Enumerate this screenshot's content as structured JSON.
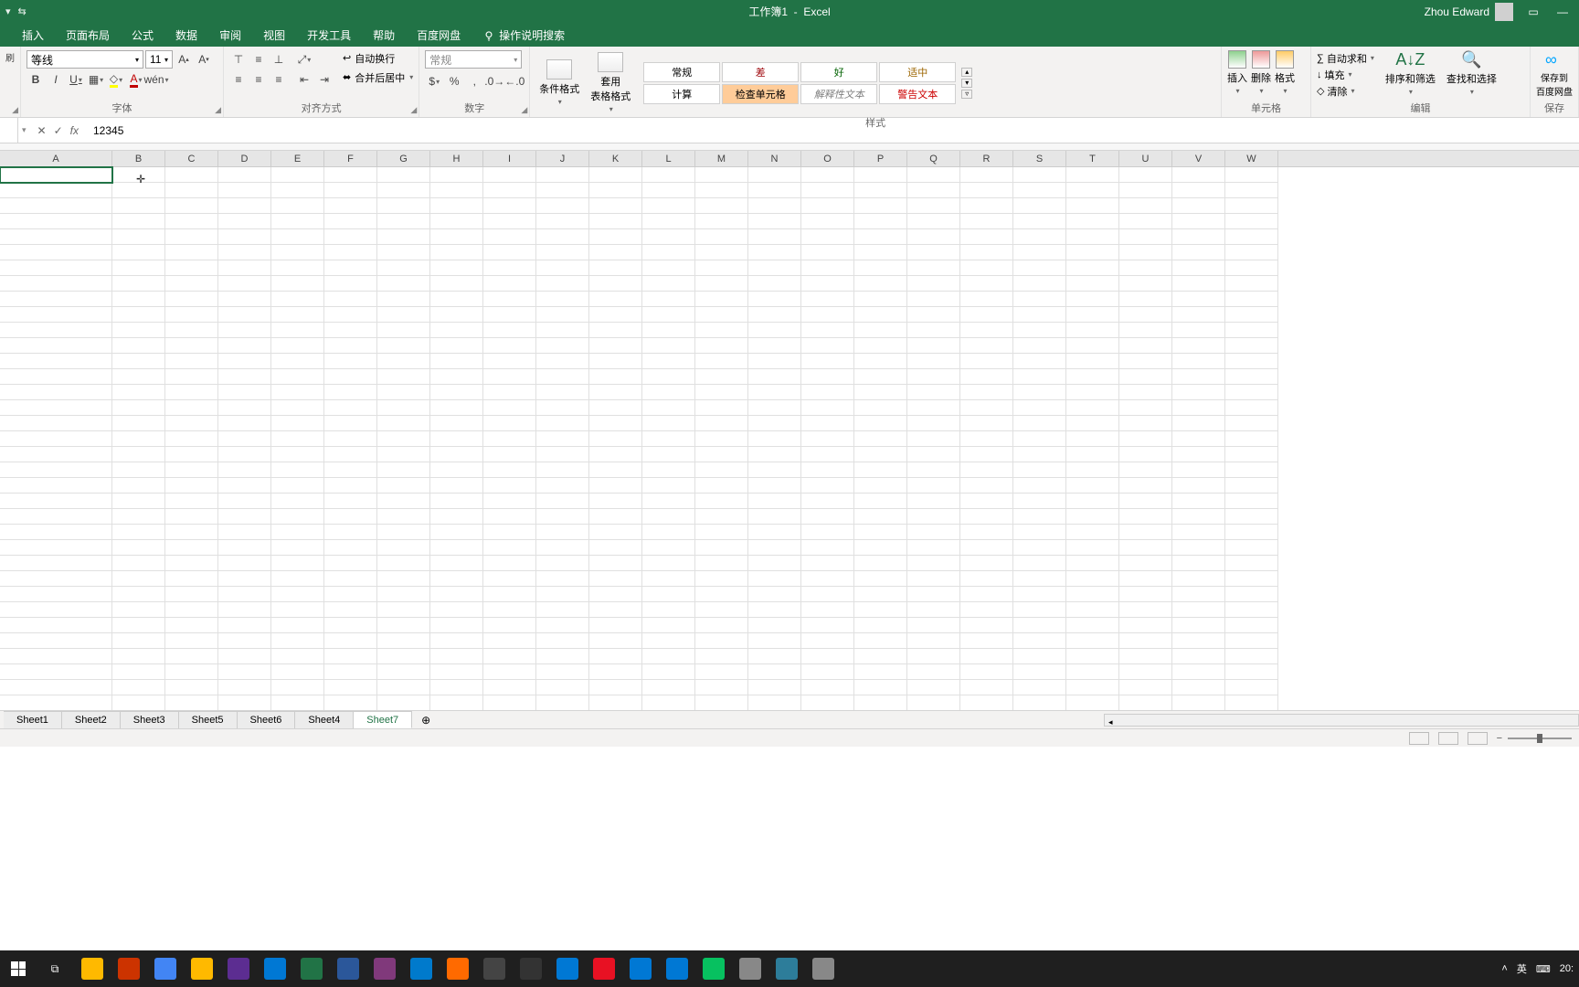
{
  "title": {
    "doc": "工作簿1",
    "sep": "-",
    "app": "Excel"
  },
  "user": {
    "name": "Zhou Edward"
  },
  "winctrl": {
    "min": "—",
    "restore": "❐"
  },
  "tabs": [
    "插入",
    "页面布局",
    "公式",
    "数据",
    "审阅",
    "视图",
    "开发工具",
    "帮助",
    "百度网盘"
  ],
  "tell_me": "操作说明搜索",
  "font": {
    "name": "等线",
    "size": "11",
    "label": "字体",
    "bold": "B",
    "italic": "I",
    "underline": "U",
    "grow": "A",
    "shrink": "A"
  },
  "align": {
    "label": "对齐方式",
    "wrap": "自动换行",
    "merge": "合并后居中"
  },
  "number": {
    "label": "数字",
    "format": "常规"
  },
  "styles": {
    "label": "样式",
    "cond": "条件格式",
    "table": "套用\n表格格式",
    "gallery": [
      "常规",
      "差",
      "好",
      "适中",
      "计算",
      "检查单元格",
      "解释性文本",
      "警告文本"
    ]
  },
  "cells": {
    "label": "单元格",
    "insert": "插入",
    "delete": "删除",
    "format": "格式"
  },
  "edit": {
    "label": "编辑",
    "autosum": "自动求和",
    "fill": "填充",
    "clear": "清除",
    "sort": "排序和筛选",
    "find": "查找和选择"
  },
  "save": {
    "label": "保存",
    "baidu": "保存到\n百度网盘"
  },
  "formula": {
    "value": "12345",
    "cancel": "✕",
    "enter": "✓",
    "fx": "fx"
  },
  "columns": [
    "A",
    "B",
    "C",
    "D",
    "E",
    "F",
    "G",
    "H",
    "I",
    "J",
    "K",
    "L",
    "M",
    "N",
    "O",
    "P",
    "Q",
    "R",
    "S",
    "T",
    "U",
    "V",
    "W"
  ],
  "sheets": [
    "Sheet1",
    "Sheet2",
    "Sheet3",
    "Sheet5",
    "Sheet6",
    "Sheet4",
    "Sheet7"
  ],
  "active_sheet": "Sheet7",
  "tray": {
    "ime_lang": "英",
    "ime_mode": "⌨",
    "time": "20:"
  },
  "taskbar_colors": [
    "#ffb900",
    "#cc3300",
    "#4285f4",
    "#ffb900",
    "#5c2d91",
    "#0078d4",
    "#217346",
    "#2b579a",
    "#80397b",
    "#007acc",
    "#ff6a00",
    "#444",
    "#333",
    "#0078d4",
    "#e81123",
    "#0078d4",
    "#0078d4",
    "#07c160",
    "#888",
    "#2d7d9a",
    "#888"
  ]
}
